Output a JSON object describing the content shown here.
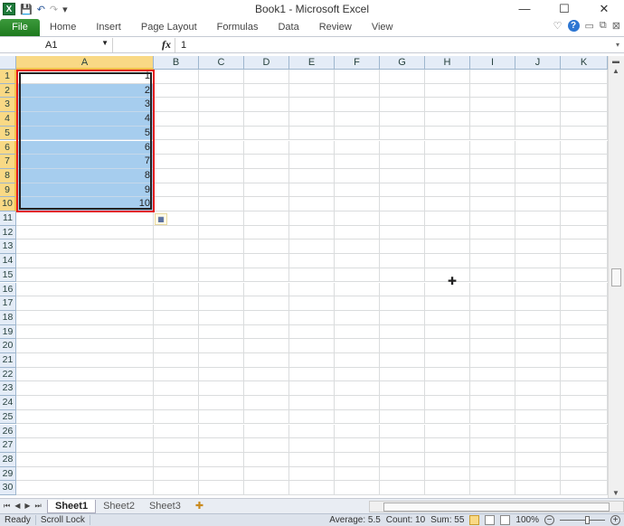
{
  "window": {
    "title": "Book1 - Microsoft Excel",
    "minimize": "—",
    "maximize": "☐",
    "close": "✕"
  },
  "qat": {
    "app_icon": "X",
    "save": "💾",
    "undo": "↶",
    "redo": "↷",
    "customize": "▾"
  },
  "ribbon": {
    "tabs": [
      "File",
      "Home",
      "Insert",
      "Page Layout",
      "Formulas",
      "Data",
      "Review",
      "View"
    ]
  },
  "formula_bar": {
    "name_box": "A1",
    "fx": "fx",
    "value": "1"
  },
  "columns": [
    "A",
    "B",
    "C",
    "D",
    "E",
    "F",
    "G",
    "H",
    "I",
    "J",
    "K"
  ],
  "selected_column": "A",
  "rows": [
    "1",
    "2",
    "3",
    "4",
    "5",
    "6",
    "7",
    "8",
    "9",
    "10",
    "11",
    "12",
    "13",
    "14",
    "15",
    "16",
    "17",
    "18",
    "19",
    "20",
    "21",
    "22",
    "23",
    "24",
    "25",
    "26",
    "27",
    "28",
    "29",
    "30"
  ],
  "cells_A": [
    "1",
    "2",
    "3",
    "4",
    "5",
    "6",
    "7",
    "8",
    "9",
    "10"
  ],
  "sheets": {
    "tabs": [
      "Sheet1",
      "Sheet2",
      "Sheet3"
    ],
    "active": "Sheet1"
  },
  "status": {
    "ready": "Ready",
    "scroll_lock": "Scroll Lock",
    "average": "Average: 5.5",
    "count": "Count: 10",
    "sum": "Sum: 55",
    "zoom": "100%"
  },
  "colors": {
    "selection": "#a6cdee",
    "highlight_border": "#e31b1b",
    "header_selected": "#f9d985"
  }
}
